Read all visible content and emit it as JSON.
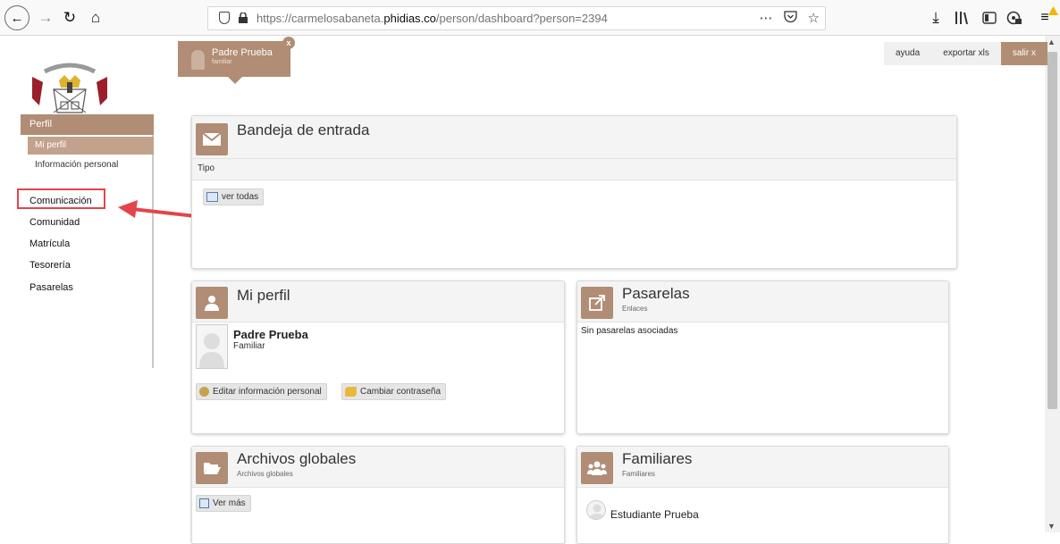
{
  "browser": {
    "url_prefix": "https://carmelosabaneta.",
    "url_domain": "phidias.co",
    "url_path": "/person/dashboard?person=2394",
    "more_icon": "⋯"
  },
  "user_tab": {
    "name": "Padre Prueba",
    "role": "familiar",
    "close": "x"
  },
  "top_links": {
    "help": "ayuda",
    "export": "exportar xls",
    "exit": "salir x"
  },
  "sidebar": {
    "header": "Perfil",
    "sub_items": [
      "Mi perfil",
      "Información personal"
    ],
    "items": [
      "Comunicación",
      "Comunidad",
      "Matrícula",
      "Tesorería",
      "Pasarelas"
    ]
  },
  "inbox": {
    "title": "Bandeja de entrada",
    "type_label": "Tipo",
    "see_all": "ver todas"
  },
  "profile": {
    "title": "Mi perfil",
    "name": "Padre Prueba",
    "role": "Familiar",
    "edit_button": "Editar información personal",
    "password_button": "Cambiar contraseña"
  },
  "gateways": {
    "title": "Pasarelas",
    "subtitle": "Enlaces",
    "empty": "Sin pasarelas asociadas"
  },
  "files": {
    "title": "Archivos globales",
    "subtitle": "Archivos globales",
    "more_button": "Ver más"
  },
  "family": {
    "title": "Familiares",
    "subtitle": "Familiares",
    "member": "Estudiante Prueba"
  },
  "colors": {
    "accent": "#b08d74",
    "highlight": "#e2454b"
  }
}
